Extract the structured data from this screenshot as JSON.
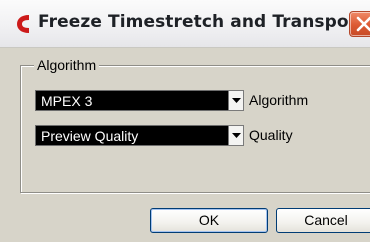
{
  "dialog": {
    "title": "Freeze Timestretch and Transpose",
    "icon": "cubase-logo-icon",
    "close_icon": "close-icon"
  },
  "group": {
    "label": "Algorithm"
  },
  "fields": {
    "algorithm": {
      "selected": "MPEX 3",
      "label": "Algorithm"
    },
    "quality": {
      "selected": "Preview Quality",
      "label": "Quality"
    }
  },
  "buttons": {
    "ok": "OK",
    "cancel": "Cancel"
  },
  "colors": {
    "dialog_bg": "#d7d4c9",
    "dropdown_bg": "#000000",
    "logo_red": "#cc1a1a",
    "close_red": "#dc5a33"
  }
}
